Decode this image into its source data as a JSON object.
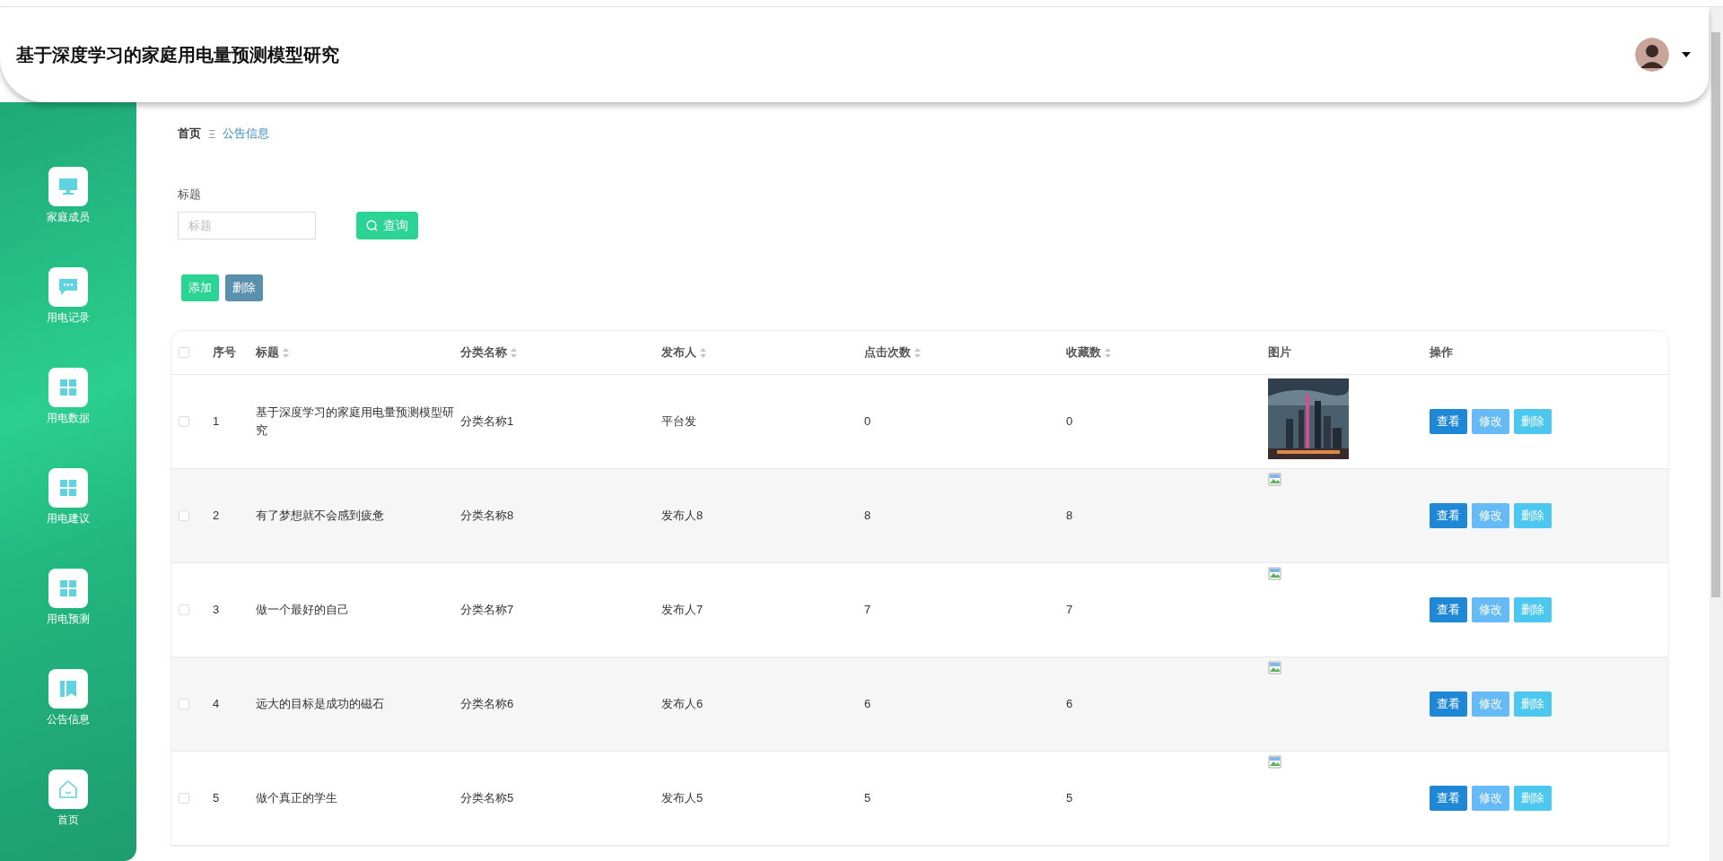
{
  "header": {
    "title": "基于深度学习的家庭用电量预测模型研究"
  },
  "sidebar": {
    "items": [
      {
        "label": "家庭成员"
      },
      {
        "label": "用电记录"
      },
      {
        "label": "用电数据"
      },
      {
        "label": "用电建议"
      },
      {
        "label": "用电预测"
      },
      {
        "label": "公告信息"
      },
      {
        "label": "首页"
      }
    ]
  },
  "breadcrumb": {
    "items": [
      "首页",
      "公告信息"
    ],
    "separator": "Ξ"
  },
  "search": {
    "label": "标题",
    "placeholder": "标题",
    "button": "查询"
  },
  "actions": [
    "添加",
    "删除"
  ],
  "table": {
    "all_checked": false,
    "columns": [
      {
        "label": "序号",
        "sortable": false
      },
      {
        "label": "标题",
        "sortable": true
      },
      {
        "label": "分类名称",
        "sortable": true
      },
      {
        "label": "发布人",
        "sortable": true
      },
      {
        "label": "点击次数",
        "sortable": true
      },
      {
        "label": "收藏数",
        "sortable": true
      },
      {
        "label": "图片",
        "sortable": false
      },
      {
        "label": "操作",
        "sortable": false
      }
    ],
    "rows": [
      {
        "checked": false,
        "cells": [
          "1",
          "基于深度学习的家庭用电量预测模型研究",
          "分类名称1",
          "平台发",
          "0",
          "0"
        ],
        "image": {
          "kind": "picture"
        },
        "buttons": [
          "查看",
          "修改",
          "删除"
        ]
      },
      {
        "checked": false,
        "cells": [
          "2",
          "有了梦想就不会感到疲惫",
          "分类名称8",
          "发布人8",
          "8",
          "8"
        ],
        "image": {
          "kind": "broken"
        },
        "buttons": [
          "查看",
          "修改",
          "删除"
        ]
      },
      {
        "checked": false,
        "cells": [
          "3",
          "做一个最好的自己",
          "分类名称7",
          "发布人7",
          "7",
          "7"
        ],
        "image": {
          "kind": "broken"
        },
        "buttons": [
          "查看",
          "修改",
          "删除"
        ]
      },
      {
        "checked": false,
        "cells": [
          "4",
          "远大的目标是成功的磁石",
          "分类名称6",
          "发布人6",
          "6",
          "6"
        ],
        "image": {
          "kind": "broken"
        },
        "buttons": [
          "查看",
          "修改",
          "删除"
        ]
      },
      {
        "checked": false,
        "cells": [
          "5",
          "做个真正的学生",
          "分类名称5",
          "发布人5",
          "5",
          "5"
        ],
        "image": {
          "kind": "broken"
        },
        "buttons": [
          "查看",
          "修改",
          "删除"
        ]
      }
    ]
  }
}
